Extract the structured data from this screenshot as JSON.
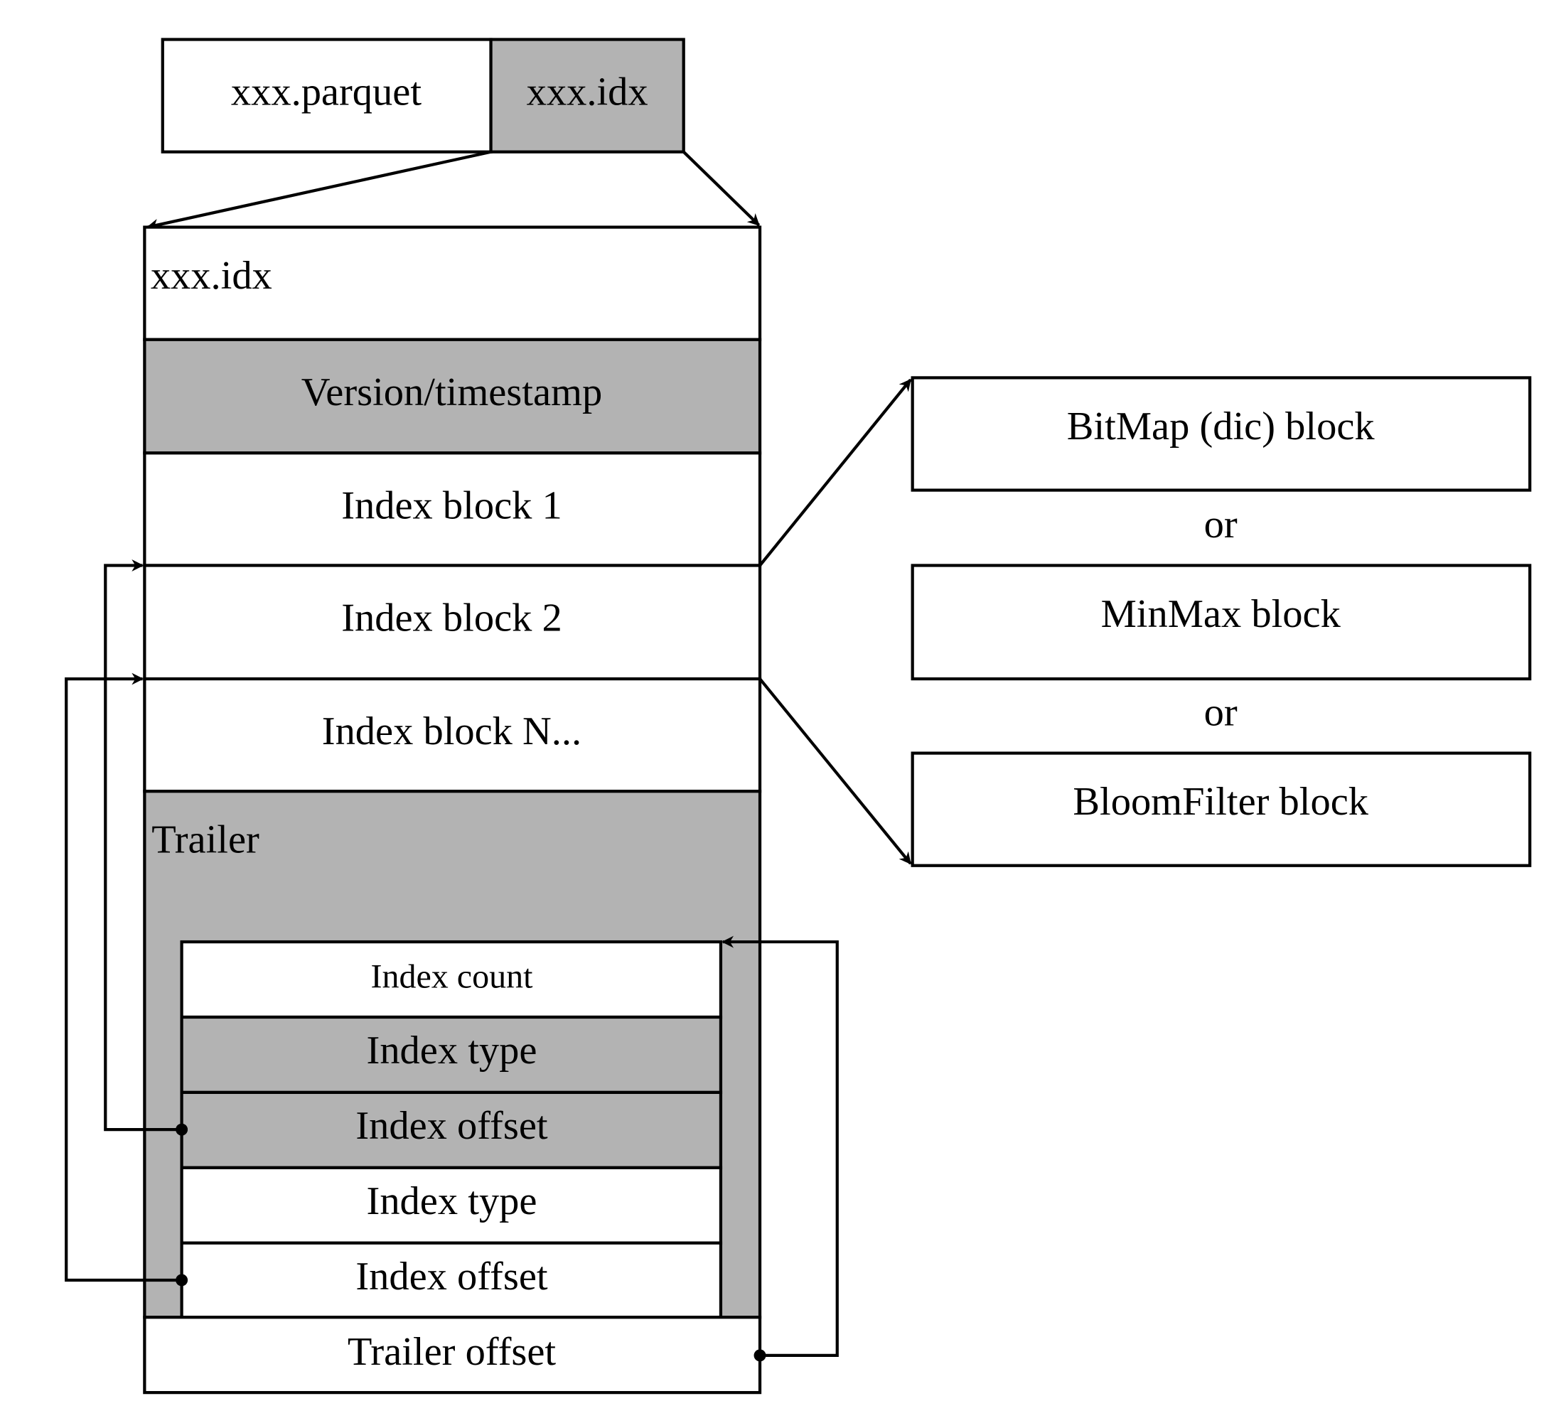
{
  "colors": {
    "gray_fill": "#b3b3b3",
    "white_fill": "#ffffff",
    "stroke": "#000000"
  },
  "top_file": {
    "parquet_label": "xxx.parquet",
    "idx_label": "xxx.idx"
  },
  "idx_file": {
    "title": "xxx.idx",
    "version": "Version/timestamp",
    "blocks": [
      "Index block 1",
      "Index block 2",
      "Index block N..."
    ],
    "trailer_title": "Trailer",
    "trailer_rows": [
      "Index count",
      "Index type",
      "Index offset",
      "Index type",
      "Index offset"
    ],
    "trailer_offset": "Trailer offset"
  },
  "block_types": {
    "items": [
      "BitMap (dic) block",
      "MinMax block",
      "BloomFilter block"
    ],
    "separator": "or"
  }
}
